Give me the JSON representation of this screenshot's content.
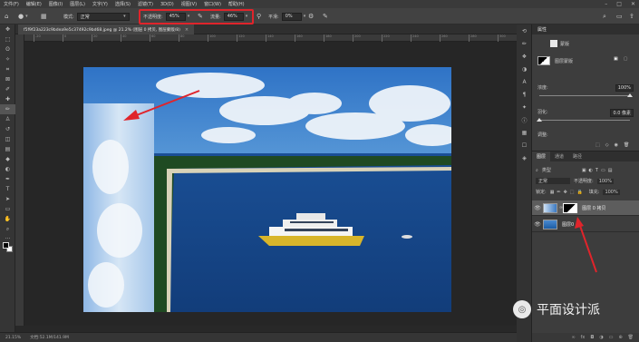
{
  "menu": [
    "文件(F)",
    "编辑(E)",
    "图像(I)",
    "图层(L)",
    "文字(Y)",
    "选择(S)",
    "滤镜(T)",
    "3D(D)",
    "视图(V)",
    "窗口(W)",
    "帮助(H)"
  ],
  "options": {
    "mode_label": "模式:",
    "mode_value": "正常",
    "opacity_label": "不透明度:",
    "opacity_value": "45%",
    "flow_label": "流量:",
    "flow_value": "46%",
    "smooth_label": "平滑:",
    "smooth_value": "0%"
  },
  "document_tab": {
    "title": "f5f9f23a223c9bdea9e5c37492c9bd68.jpeg @ 21.2% (图层 0 拷贝, 图层蒙版/8)",
    "close": "×"
  },
  "ruler_ticks": [
    "-20",
    "0",
    "20",
    "40",
    "60",
    "80",
    "100",
    "120",
    "140",
    "160",
    "180",
    "200",
    "220",
    "240",
    "260",
    "280",
    "300"
  ],
  "status": {
    "zoom": "21.15%",
    "doc_size": "文档:52.1M/141.9M"
  },
  "properties": {
    "title": "属性",
    "mask_title": "蒙版",
    "layer_mask_label": "图层蒙版",
    "density_label": "浓度:",
    "density_value": "100%",
    "feather_label": "羽化:",
    "feather_value": "0.0 像素",
    "adjust_label": "调整:"
  },
  "layers_panel": {
    "tabs": [
      "图层",
      "通道",
      "路径"
    ],
    "kind_label": "类型",
    "blend_mode": "正常",
    "opacity_label": "不透明度:",
    "opacity_value": "100%",
    "lock_label": "锁定:",
    "fill_label": "填充:",
    "fill_value": "100%",
    "layers": [
      {
        "name": "图层 0 拷贝",
        "selected": true
      },
      {
        "name": "图层0",
        "selected": false
      }
    ]
  },
  "watermark": {
    "text": "平面设计派"
  },
  "colors": {
    "accent_red": "#e0242b",
    "sea": "#1d5ca4"
  }
}
